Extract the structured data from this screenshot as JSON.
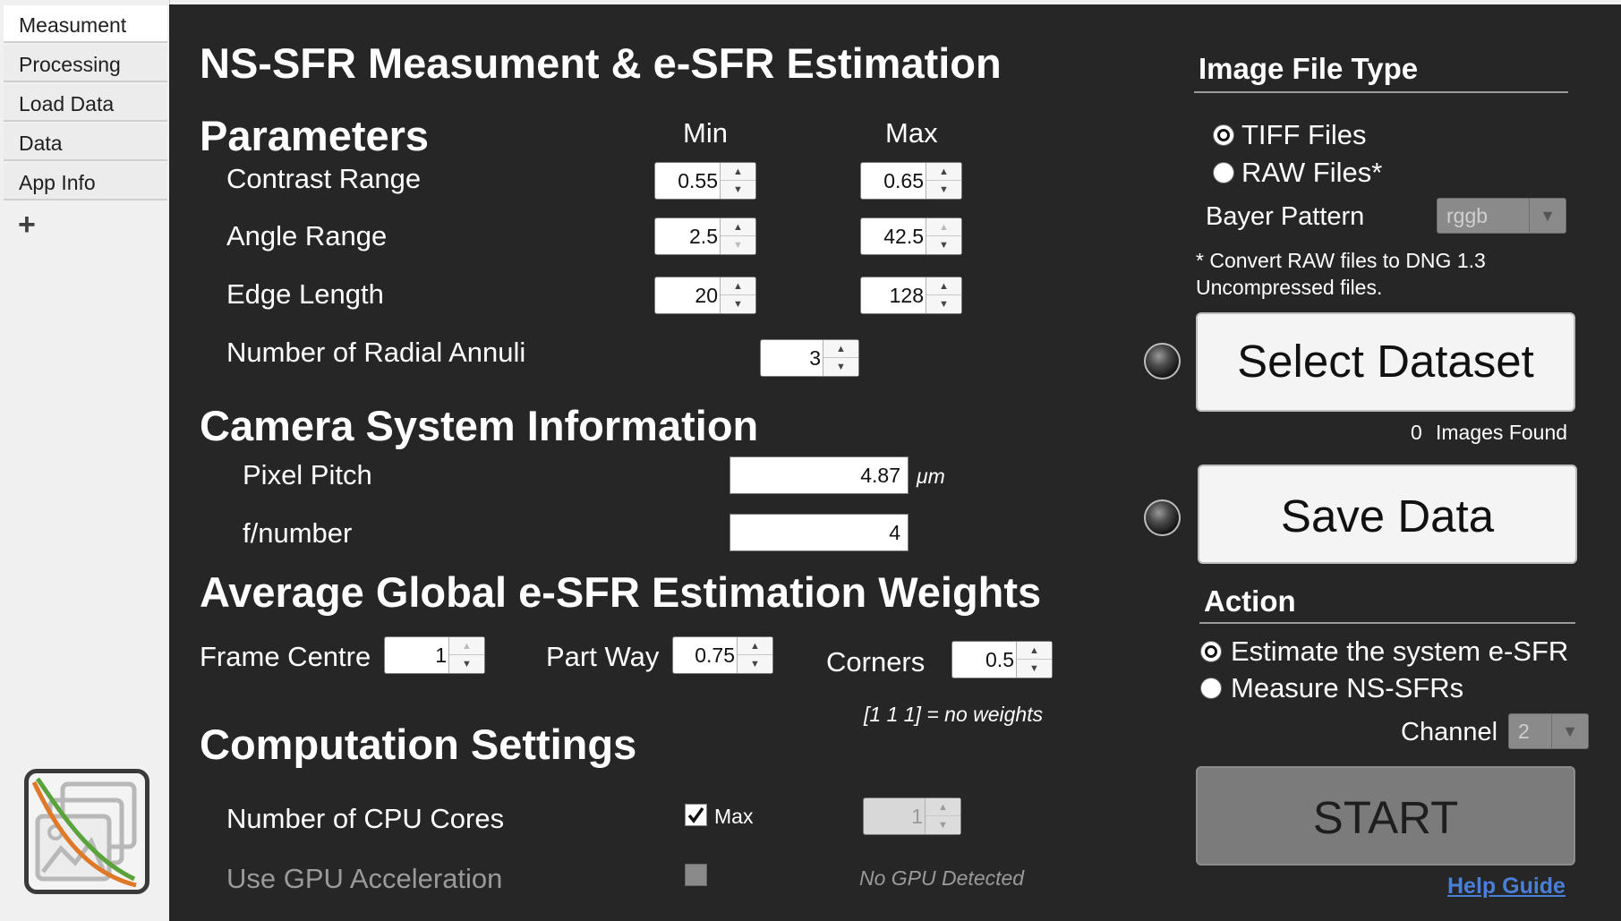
{
  "sidebar": {
    "tabs": [
      {
        "label": "Measument"
      },
      {
        "label": "Processing"
      },
      {
        "label": "Load Data"
      },
      {
        "label": "Data"
      },
      {
        "label": "App Info"
      }
    ],
    "add_tab": "+"
  },
  "main": {
    "title": "NS-SFR Measument & e-SFR Estimation",
    "parameters": {
      "heading": "Parameters",
      "min_label": "Min",
      "max_label": "Max",
      "contrast_label": "Contrast Range",
      "contrast_min": "0.55",
      "contrast_max": "0.65",
      "angle_label": "Angle Range",
      "angle_min": "2.5",
      "angle_max": "42.5",
      "edge_label": "Edge Length",
      "edge_min": "20",
      "edge_max": "128",
      "annuli_label": "Number of Radial Annuli",
      "annuli_value": "3"
    },
    "camera": {
      "heading": "Camera System Information",
      "pixel_pitch_label": "Pixel Pitch",
      "pixel_pitch_value": "4.87",
      "pixel_pitch_unit": "μm",
      "fnumber_label": "f/number",
      "fnumber_value": "4"
    },
    "weights": {
      "heading": "Average Global e-SFR Estimation Weights",
      "frame_centre_label": "Frame Centre",
      "frame_centre_value": "1",
      "part_way_label": "Part Way",
      "part_way_value": "0.75",
      "corners_label": "Corners",
      "corners_value": "0.5",
      "note": "[1 1 1] = no weights"
    },
    "computation": {
      "heading": "Computation Settings",
      "cpu_label": "Number of CPU Cores",
      "cpu_max_label": "Max",
      "cpu_max_checked": true,
      "cpu_value": "1",
      "gpu_label": "Use GPU Acceleration",
      "gpu_checked": false,
      "gpu_status": "No GPU Detected"
    }
  },
  "right": {
    "file_type": {
      "heading": "Image File Type",
      "options": [
        "TIFF Files",
        "RAW Files*"
      ],
      "selected": "TIFF Files",
      "bayer_label": "Bayer Pattern",
      "bayer_value": "rggb",
      "note_line1": "* Convert RAW files to DNG 1.3",
      "note_line2": "Uncompressed files."
    },
    "select_dataset_label": "Select Dataset",
    "images_found_count": "0",
    "images_found_label": "Images Found",
    "save_data_label": "Save Data",
    "action": {
      "heading": "Action",
      "options": [
        "Estimate the system e-SFR",
        "Measure NS-SFRs"
      ],
      "selected": "Estimate the system e-SFR",
      "channel_label": "Channel",
      "channel_value": "2"
    },
    "start_label": "START",
    "help_label": "Help Guide"
  },
  "colors": {
    "panel_bg": "#262626",
    "sidebar_bg": "#f0f0f0",
    "link": "#4a7fd8",
    "start_button": "#7b7b7b"
  }
}
